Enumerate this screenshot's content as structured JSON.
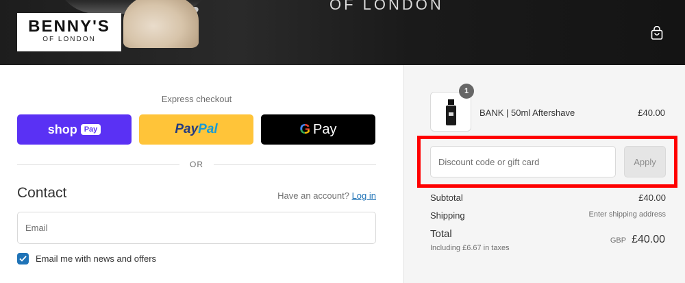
{
  "header": {
    "banner_text": "OF LONDON",
    "logo_main": "BENNY'S",
    "logo_sub": "OF LONDON",
    "cart_icon": "shopping-bag-icon"
  },
  "express": {
    "label": "Express checkout",
    "shop_pay": {
      "text": "shop",
      "badge": "Pay",
      "color": "#5a31f4"
    },
    "paypal": {
      "part1": "Pay",
      "part2": "Pal",
      "color": "#ffc439"
    },
    "gpay": {
      "g": "G",
      "text": "Pay"
    },
    "or_label": "OR"
  },
  "contact": {
    "title": "Contact",
    "account_prompt": "Have an account?",
    "login_link": "Log in",
    "email_placeholder": "Email",
    "newsletter_label": "Email me with news and offers",
    "newsletter_checked": true
  },
  "summary": {
    "item": {
      "quantity": "1",
      "name": "BANK | 50ml Aftershave",
      "price": "£40.00"
    },
    "discount_placeholder": "Discount code or gift card",
    "apply_label": "Apply",
    "subtotal_label": "Subtotal",
    "subtotal_value": "£40.00",
    "shipping_label": "Shipping",
    "shipping_value": "Enter shipping address",
    "total_label": "Total",
    "tax_note": "Including £6.67 in taxes",
    "currency": "GBP",
    "total_value": "£40.00"
  },
  "colors": {
    "accent": "#1f73b7",
    "highlight": "#ff0000"
  }
}
